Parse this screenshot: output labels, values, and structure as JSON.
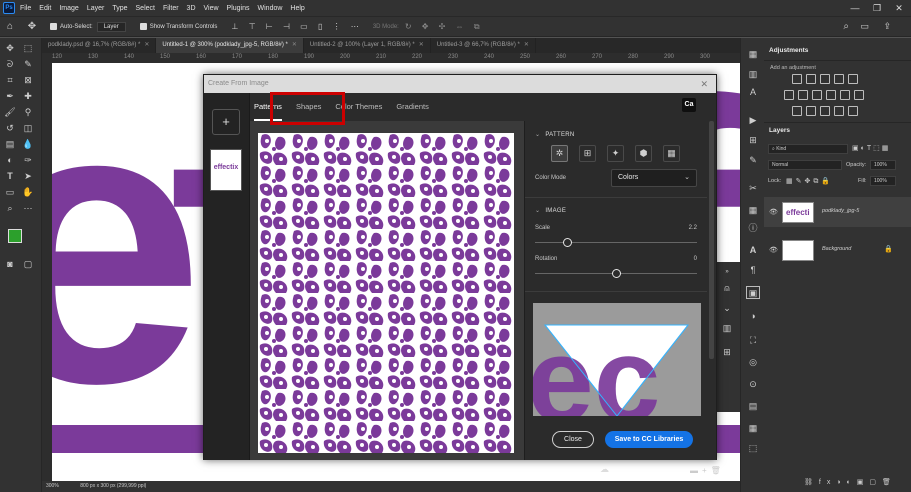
{
  "app": {
    "logo": "Ps",
    "menu": [
      "File",
      "Edit",
      "Image",
      "Layer",
      "Type",
      "Select",
      "Filter",
      "3D",
      "View",
      "Plugins",
      "Window",
      "Help"
    ],
    "window_controls": [
      "—",
      "❐",
      "✕"
    ]
  },
  "options_bar": {
    "auto_select_label": "Auto-Select:",
    "auto_select_value": "Layer",
    "transform_label": "Show Transform Controls",
    "mode_3d_label": "3D Mode:"
  },
  "doc_tabs": [
    {
      "label": "podklady.psd @ 16,7% (RGB/8#) *",
      "active": false
    },
    {
      "label": "Untitled-1 @ 300% (podklady_jpg-5, RGB/8#) *",
      "active": true
    },
    {
      "label": "Untitled-2 @ 100% (Layer 1, RGB/8#) *",
      "active": false
    },
    {
      "label": "Untitled-3 @ 66,7% (RGB/8#) *",
      "active": false
    }
  ],
  "ruler_marks": [
    "120",
    "130",
    "140",
    "150",
    "160",
    "170",
    "180",
    "190",
    "200",
    "210",
    "220",
    "230",
    "240",
    "250",
    "260",
    "270",
    "280",
    "290",
    "300"
  ],
  "status": {
    "zoom": "300%",
    "doc_size": "800 px x 300 px (299,999 ppi)"
  },
  "dialog": {
    "title": "Create From Image",
    "close_glyph": "✕",
    "add_glyph": "+",
    "thumb_label": "effectix",
    "tabs": [
      {
        "label": "Patterns",
        "active": true
      },
      {
        "label": "Shapes",
        "active": false
      },
      {
        "label": "Color Themes",
        "active": false
      },
      {
        "label": "Gradients",
        "active": false
      }
    ],
    "cc_badge": "Ca",
    "pattern_section": "PATTERN",
    "color_mode_label": "Color Mode",
    "color_mode_value": "Colors",
    "image_section": "IMAGE",
    "scale_label": "Scale",
    "scale_value": "2.2",
    "scale_level": 0.2,
    "rotation_label": "Rotation",
    "rotation_value": "0",
    "rotation_level": 0.5,
    "close_button": "Close",
    "save_button": "Save to CC Libraries"
  },
  "panels": {
    "adjustments_title": "Adjustments",
    "add_adjustment": "Add an adjustment",
    "layers_title": "Layers",
    "kind_label": "Kind",
    "blend_mode": "Normal",
    "opacity_label": "Opacity:",
    "opacity_value": "100%",
    "lock_label": "Lock:",
    "fill_label": "Fill:",
    "fill_value": "100%",
    "layers": [
      {
        "name": "podklady_jpg-5",
        "thumb_text": "effecti"
      },
      {
        "name": "Background",
        "thumb_text": ""
      }
    ]
  },
  "colors": {
    "purple": "#7b3a9a",
    "accent_blue": "#1473e6",
    "highlight_red": "#cc0000",
    "fg_swatch": "#2ca02c",
    "bg_swatch": "#000000"
  }
}
